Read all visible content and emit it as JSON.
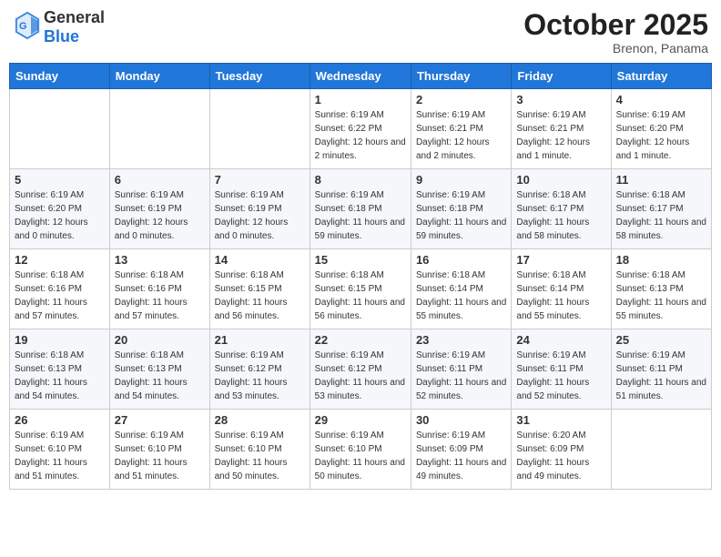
{
  "header": {
    "logo_general": "General",
    "logo_blue": "Blue",
    "month": "October 2025",
    "location": "Brenon, Panama"
  },
  "weekdays": [
    "Sunday",
    "Monday",
    "Tuesday",
    "Wednesday",
    "Thursday",
    "Friday",
    "Saturday"
  ],
  "weeks": [
    [
      {
        "day": "",
        "sunrise": "",
        "sunset": "",
        "daylight": ""
      },
      {
        "day": "",
        "sunrise": "",
        "sunset": "",
        "daylight": ""
      },
      {
        "day": "",
        "sunrise": "",
        "sunset": "",
        "daylight": ""
      },
      {
        "day": "1",
        "sunrise": "Sunrise: 6:19 AM",
        "sunset": "Sunset: 6:22 PM",
        "daylight": "Daylight: 12 hours and 2 minutes."
      },
      {
        "day": "2",
        "sunrise": "Sunrise: 6:19 AM",
        "sunset": "Sunset: 6:21 PM",
        "daylight": "Daylight: 12 hours and 2 minutes."
      },
      {
        "day": "3",
        "sunrise": "Sunrise: 6:19 AM",
        "sunset": "Sunset: 6:21 PM",
        "daylight": "Daylight: 12 hours and 1 minute."
      },
      {
        "day": "4",
        "sunrise": "Sunrise: 6:19 AM",
        "sunset": "Sunset: 6:20 PM",
        "daylight": "Daylight: 12 hours and 1 minute."
      }
    ],
    [
      {
        "day": "5",
        "sunrise": "Sunrise: 6:19 AM",
        "sunset": "Sunset: 6:20 PM",
        "daylight": "Daylight: 12 hours and 0 minutes."
      },
      {
        "day": "6",
        "sunrise": "Sunrise: 6:19 AM",
        "sunset": "Sunset: 6:19 PM",
        "daylight": "Daylight: 12 hours and 0 minutes."
      },
      {
        "day": "7",
        "sunrise": "Sunrise: 6:19 AM",
        "sunset": "Sunset: 6:19 PM",
        "daylight": "Daylight: 12 hours and 0 minutes."
      },
      {
        "day": "8",
        "sunrise": "Sunrise: 6:19 AM",
        "sunset": "Sunset: 6:18 PM",
        "daylight": "Daylight: 11 hours and 59 minutes."
      },
      {
        "day": "9",
        "sunrise": "Sunrise: 6:19 AM",
        "sunset": "Sunset: 6:18 PM",
        "daylight": "Daylight: 11 hours and 59 minutes."
      },
      {
        "day": "10",
        "sunrise": "Sunrise: 6:18 AM",
        "sunset": "Sunset: 6:17 PM",
        "daylight": "Daylight: 11 hours and 58 minutes."
      },
      {
        "day": "11",
        "sunrise": "Sunrise: 6:18 AM",
        "sunset": "Sunset: 6:17 PM",
        "daylight": "Daylight: 11 hours and 58 minutes."
      }
    ],
    [
      {
        "day": "12",
        "sunrise": "Sunrise: 6:18 AM",
        "sunset": "Sunset: 6:16 PM",
        "daylight": "Daylight: 11 hours and 57 minutes."
      },
      {
        "day": "13",
        "sunrise": "Sunrise: 6:18 AM",
        "sunset": "Sunset: 6:16 PM",
        "daylight": "Daylight: 11 hours and 57 minutes."
      },
      {
        "day": "14",
        "sunrise": "Sunrise: 6:18 AM",
        "sunset": "Sunset: 6:15 PM",
        "daylight": "Daylight: 11 hours and 56 minutes."
      },
      {
        "day": "15",
        "sunrise": "Sunrise: 6:18 AM",
        "sunset": "Sunset: 6:15 PM",
        "daylight": "Daylight: 11 hours and 56 minutes."
      },
      {
        "day": "16",
        "sunrise": "Sunrise: 6:18 AM",
        "sunset": "Sunset: 6:14 PM",
        "daylight": "Daylight: 11 hours and 55 minutes."
      },
      {
        "day": "17",
        "sunrise": "Sunrise: 6:18 AM",
        "sunset": "Sunset: 6:14 PM",
        "daylight": "Daylight: 11 hours and 55 minutes."
      },
      {
        "day": "18",
        "sunrise": "Sunrise: 6:18 AM",
        "sunset": "Sunset: 6:13 PM",
        "daylight": "Daylight: 11 hours and 55 minutes."
      }
    ],
    [
      {
        "day": "19",
        "sunrise": "Sunrise: 6:18 AM",
        "sunset": "Sunset: 6:13 PM",
        "daylight": "Daylight: 11 hours and 54 minutes."
      },
      {
        "day": "20",
        "sunrise": "Sunrise: 6:18 AM",
        "sunset": "Sunset: 6:13 PM",
        "daylight": "Daylight: 11 hours and 54 minutes."
      },
      {
        "day": "21",
        "sunrise": "Sunrise: 6:19 AM",
        "sunset": "Sunset: 6:12 PM",
        "daylight": "Daylight: 11 hours and 53 minutes."
      },
      {
        "day": "22",
        "sunrise": "Sunrise: 6:19 AM",
        "sunset": "Sunset: 6:12 PM",
        "daylight": "Daylight: 11 hours and 53 minutes."
      },
      {
        "day": "23",
        "sunrise": "Sunrise: 6:19 AM",
        "sunset": "Sunset: 6:11 PM",
        "daylight": "Daylight: 11 hours and 52 minutes."
      },
      {
        "day": "24",
        "sunrise": "Sunrise: 6:19 AM",
        "sunset": "Sunset: 6:11 PM",
        "daylight": "Daylight: 11 hours and 52 minutes."
      },
      {
        "day": "25",
        "sunrise": "Sunrise: 6:19 AM",
        "sunset": "Sunset: 6:11 PM",
        "daylight": "Daylight: 11 hours and 51 minutes."
      }
    ],
    [
      {
        "day": "26",
        "sunrise": "Sunrise: 6:19 AM",
        "sunset": "Sunset: 6:10 PM",
        "daylight": "Daylight: 11 hours and 51 minutes."
      },
      {
        "day": "27",
        "sunrise": "Sunrise: 6:19 AM",
        "sunset": "Sunset: 6:10 PM",
        "daylight": "Daylight: 11 hours and 51 minutes."
      },
      {
        "day": "28",
        "sunrise": "Sunrise: 6:19 AM",
        "sunset": "Sunset: 6:10 PM",
        "daylight": "Daylight: 11 hours and 50 minutes."
      },
      {
        "day": "29",
        "sunrise": "Sunrise: 6:19 AM",
        "sunset": "Sunset: 6:10 PM",
        "daylight": "Daylight: 11 hours and 50 minutes."
      },
      {
        "day": "30",
        "sunrise": "Sunrise: 6:19 AM",
        "sunset": "Sunset: 6:09 PM",
        "daylight": "Daylight: 11 hours and 49 minutes."
      },
      {
        "day": "31",
        "sunrise": "Sunrise: 6:20 AM",
        "sunset": "Sunset: 6:09 PM",
        "daylight": "Daylight: 11 hours and 49 minutes."
      },
      {
        "day": "",
        "sunrise": "",
        "sunset": "",
        "daylight": ""
      }
    ]
  ]
}
